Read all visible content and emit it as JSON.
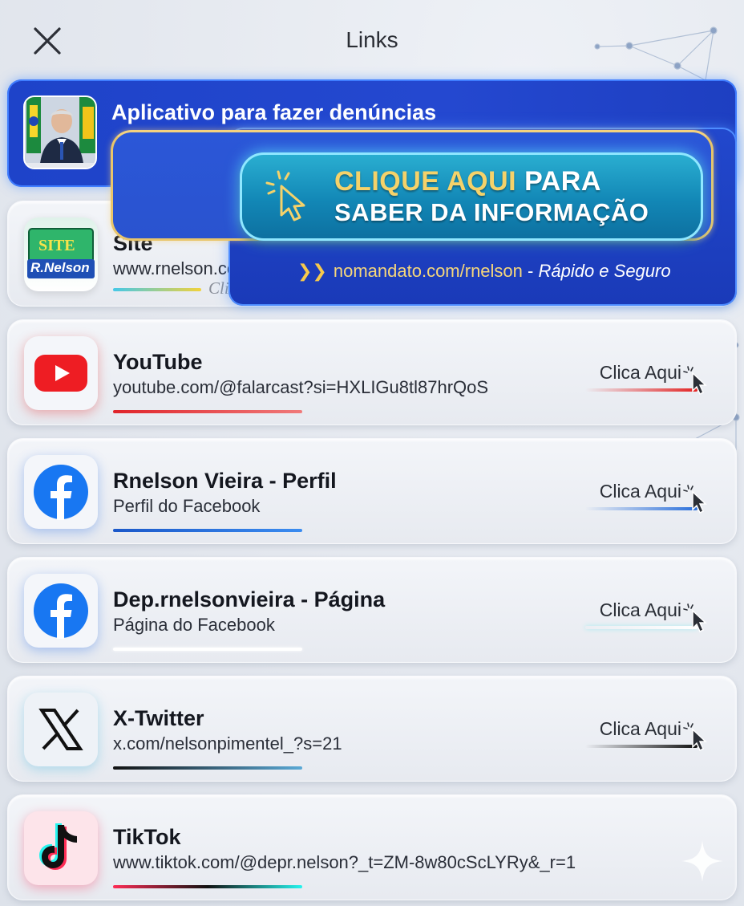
{
  "header": {
    "title": "Links",
    "close_icon": "close-icon"
  },
  "banner": {
    "title": "Aplicativo para fazer denúncias",
    "cta_word1": "CLIQUE AQUI",
    "cta_word2": " PARA",
    "cta_line2": "SABER DA INFORMAÇÃO",
    "url_text": "nomandato.com/rnelson",
    "url_separator": " - ",
    "url_tagline": "Rápido e Seguro",
    "colors": {
      "bg": "#2248cd",
      "gold": "#e9c56a",
      "cta": "#1287b6"
    }
  },
  "links": [
    {
      "name": "Site",
      "sub": "www.rnelson.com.br",
      "cta": "Clica Aqui",
      "icon": "site-logo-icon",
      "logo_text_top": "SITE",
      "logo_text_bottom": "R.Nelson",
      "bar_color": "#f2d23c"
    },
    {
      "name": "YouTube",
      "sub": "youtube.com/@falarcast?si=HXLIGu8tl87hrQoS",
      "cta": "Clica Aqui",
      "icon": "youtube-icon",
      "bar_color": "#e32424"
    },
    {
      "name": "Rnelson Vieira - Perfil",
      "sub": "Perfil do Facebook",
      "cta": "Clica Aqui",
      "icon": "facebook-icon",
      "bar_color": "#2a6fdb"
    },
    {
      "name": "Dep.rnelsonvieira - Página",
      "sub": "Página do Facebook",
      "cta": "Clica Aqui",
      "icon": "facebook-icon",
      "bar_color": "#ffffff"
    },
    {
      "name": "X-Twitter",
      "sub": "x.com/nelsonpimentel_?s=21",
      "cta": "Clica Aqui",
      "icon": "x-twitter-icon",
      "bar_color": "#111111"
    },
    {
      "name": "TikTok",
      "sub": "www.tiktok.com/@depr.nelson?_t=ZM-8w80cScLYRy&_r=1",
      "cta": "",
      "icon": "tiktok-icon",
      "bar_color": "#fe2c55"
    }
  ]
}
